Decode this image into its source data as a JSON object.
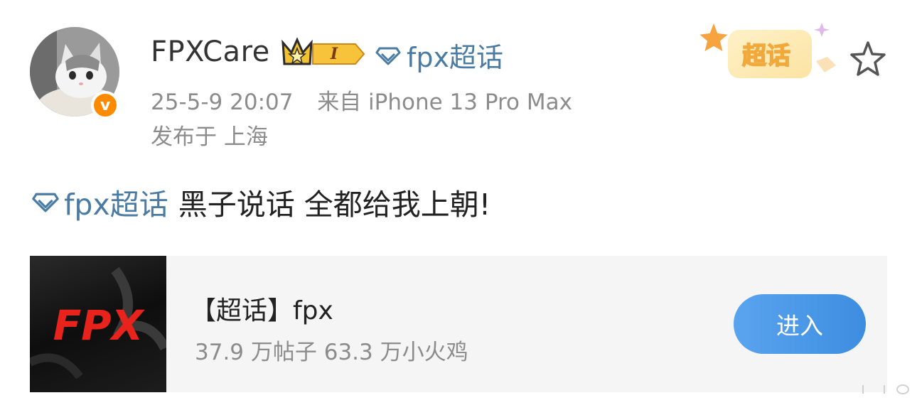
{
  "post": {
    "username": "FPXCare",
    "level_badge": "I",
    "topic_link": "fpx超话",
    "timestamp": "25-5-9 20:07",
    "source": "来自 iPhone 13 Pro Max",
    "location": "发布于 上海",
    "super_topic_badge": "超话",
    "verified_badge": "v",
    "body": {
      "topic_link": "fpx超话",
      "text": "黑子说话 全都给我上朝!"
    }
  },
  "card": {
    "thumb_text": "FPX",
    "title": "【超话】fpx",
    "stats": "37.9 万帖子 63.3 万小火鸡",
    "enter_label": "进入"
  },
  "icons": {
    "diamond": "diamond-icon",
    "crown": "crown-icon",
    "star": "star-outline-icon"
  },
  "colors": {
    "link": "#4a7ca3",
    "accent_orange": "#ff8a00",
    "button": "#3d8de0"
  }
}
